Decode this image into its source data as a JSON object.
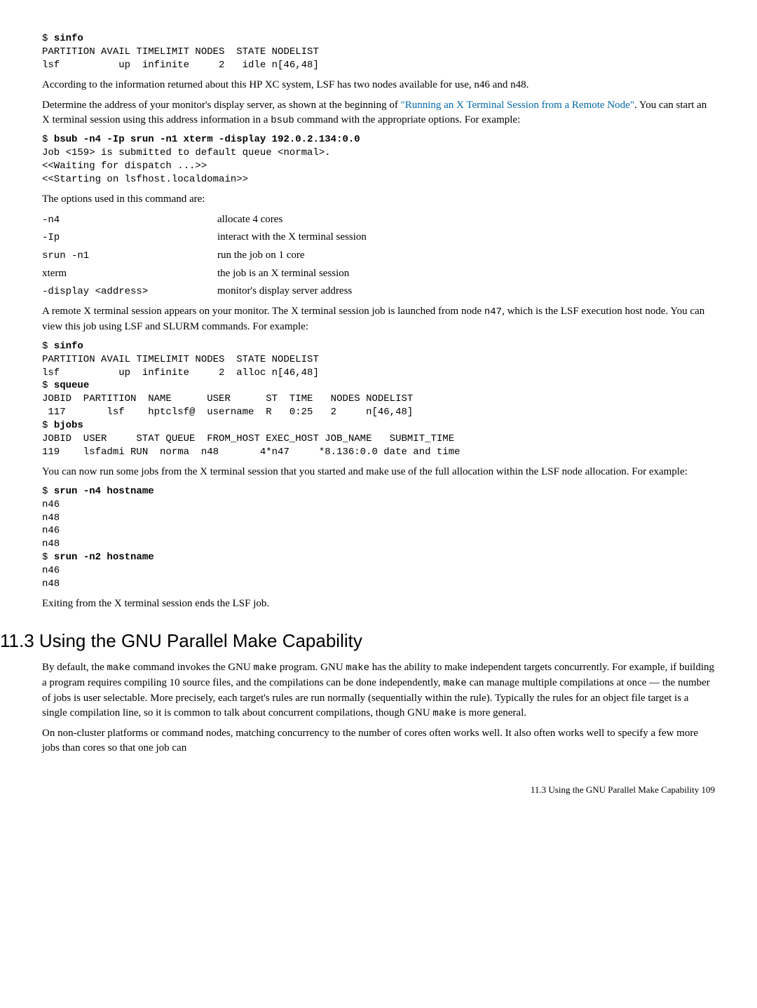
{
  "code1": "$ sinfo\nPARTITION AVAIL TIMELIMIT NODES  STATE NODELIST\nlsf          up  infinite     2   idle n[46,48]",
  "cmd1": "sinfo",
  "para1a": "According to the information returned about this HP XC system, LSF has two nodes available for use, n46 and n48.",
  "para2a": "Determine the address of your monitor's display server, as shown at the beginning of ",
  "link1": "\"Running an X Terminal Session from a Remote Node\"",
  "para2b": ". You can start an X terminal session using this address information in a ",
  "para2_code": "bsub",
  "para2c": " command with the appropriate options. For example:",
  "code2": "$ bsub -n4 -Ip srun -n1 xterm -display 192.0.2.134:0.0\nJob <159> is submitted to default queue <normal>.\n<<Waiting for dispatch ...>>\n<<Starting on lsfhost.localdomain>>",
  "cmd2": "bsub -n4 -Ip srun -n1 xterm -display 192.0.2.134:0.0",
  "para3": "The options used in this command are:",
  "opts": [
    {
      "key": "-n4",
      "val": "allocate 4 cores",
      "mono": true
    },
    {
      "key": "-Ip",
      "val": "interact with the X terminal session",
      "mono": true
    },
    {
      "key": "srun -n1",
      "val": "run the job on 1 core",
      "mono": true
    },
    {
      "key": "xterm",
      "val": "the job is an X terminal session",
      "mono": false
    },
    {
      "key": "-display <address>",
      "val": "monitor's display server address",
      "mono": true
    }
  ],
  "para4a": "A remote X terminal session appears on your monitor. The X terminal session job is launched from node ",
  "para4_code": "n47",
  "para4b": ", which is the LSF execution host node. You can view this job using LSF and SLURM commands. For example:",
  "code3_l1": "$ sinfo",
  "cmd3a": "sinfo",
  "code3_l2": "PARTITION AVAIL TIMELIMIT NODES  STATE NODELIST\nlsf          up  infinite     2  alloc n[46,48]",
  "code3_l3": "$ squeue",
  "cmd3b": "squeue",
  "code3_l4": "JOBID  PARTITION  NAME      USER      ST  TIME   NODES NODELIST\n 117       lsf    hptclsf@  username  R   0:25   2     n[46,48]",
  "code3_l5": "$ bjobs",
  "cmd3c": "bjobs",
  "code3_l6": "JOBID  USER     STAT QUEUE  FROM_HOST EXEC_HOST JOB_NAME   SUBMIT_TIME\n119    lsfadmi RUN  norma  n48       4*n47     *8.136:0.0 date and time",
  "para5": "You can now run some jobs from the X terminal session that you started and make use of the full allocation within the LSF node allocation. For example:",
  "code4_l1": "$ srun -n4 hostname",
  "cmd4a": "srun -n4 hostname",
  "code4_l2": "n46\nn48\nn46\nn48",
  "code4_l3": "$ srun -n2 hostname",
  "cmd4b": "srun -n2 hostname",
  "code4_l4": "n46\nn48",
  "para6": "Exiting from the X terminal session ends the LSF job.",
  "section_title": "11.3 Using the GNU Parallel Make Capability",
  "para7a": "By default, the ",
  "para7b": " command invokes the GNU ",
  "para7c": " program. GNU ",
  "para7d": " has the ability to make independent targets concurrently. For example, if building a program requires compiling 10 source files, and the compilations can be done independently, ",
  "para7e": " can manage multiple compilations at once — the number of jobs is user selectable. More precisely, each target's rules are run normally (sequentially within the rule). Typically the rules for an object file target is a single compilation line, so it is common to talk about concurrent compilations, though GNU ",
  "para7f": " is more general.",
  "code_make": "make",
  "para8": "On non-cluster platforms or command nodes, matching concurrency to the number of cores often works well. It also often works well to specify a few more jobs than cores so that one job can",
  "footer": "11.3 Using the GNU Parallel Make Capability    109"
}
